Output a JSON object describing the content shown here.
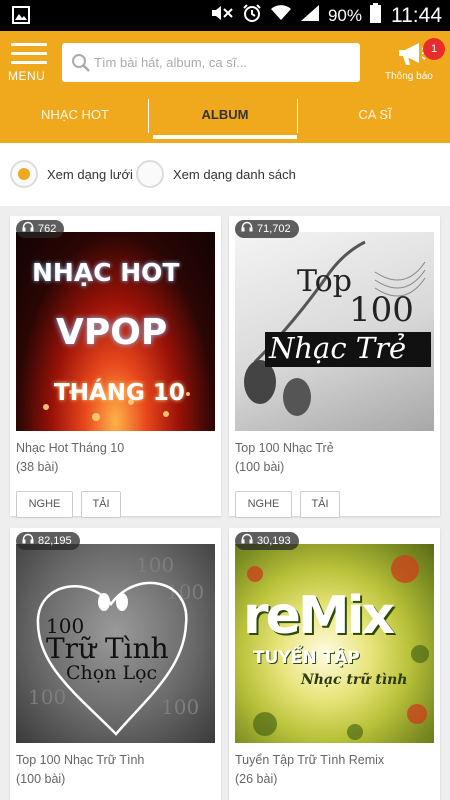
{
  "status_bar": {
    "battery_percent": "90%",
    "time": "11:44"
  },
  "header": {
    "menu_label": "MENU",
    "search_placeholder": "Tìm bài hát, album, ca sĩ...",
    "notification_label": "Thông báo",
    "notification_count": "1"
  },
  "tabs": [
    {
      "label": "NHẠC HOT",
      "active": false
    },
    {
      "label": "ALBUM",
      "active": true
    },
    {
      "label": "CA SĨ",
      "active": false
    }
  ],
  "view_options": {
    "grid_label": "Xem dạng lưới",
    "list_label": "Xem dạng danh sách",
    "selected": "grid"
  },
  "buttons": {
    "play": "NGHE",
    "download": "TẢI"
  },
  "albums": [
    {
      "listens": "762",
      "title": "Nhạc Hot Tháng 10",
      "tracks": "(38 bài)",
      "cover_text": [
        "NHẠC HOT",
        "VPOP",
        "THÁNG 10"
      ]
    },
    {
      "listens": "71,702",
      "title": "Top 100 Nhạc Trẻ",
      "tracks": "(100 bài)",
      "cover_text": [
        "Top",
        "100",
        "Nhạc Trẻ"
      ]
    },
    {
      "listens": "82,195",
      "title": "Top 100 Nhạc Trữ Tình",
      "tracks": "(100 bài)",
      "cover_text": [
        "100",
        "Trữ Tình",
        "Chọn Lọc"
      ]
    },
    {
      "listens": "30,193",
      "title": "Tuyển Tập Trữ Tình Remix",
      "tracks": "(26 bài)",
      "cover_text": [
        "reMix",
        "TUYỂN TẬP",
        "Nhạc trữ tình"
      ]
    }
  ],
  "colors": {
    "accent": "#f0a81c",
    "badge": "#e82c2c"
  }
}
